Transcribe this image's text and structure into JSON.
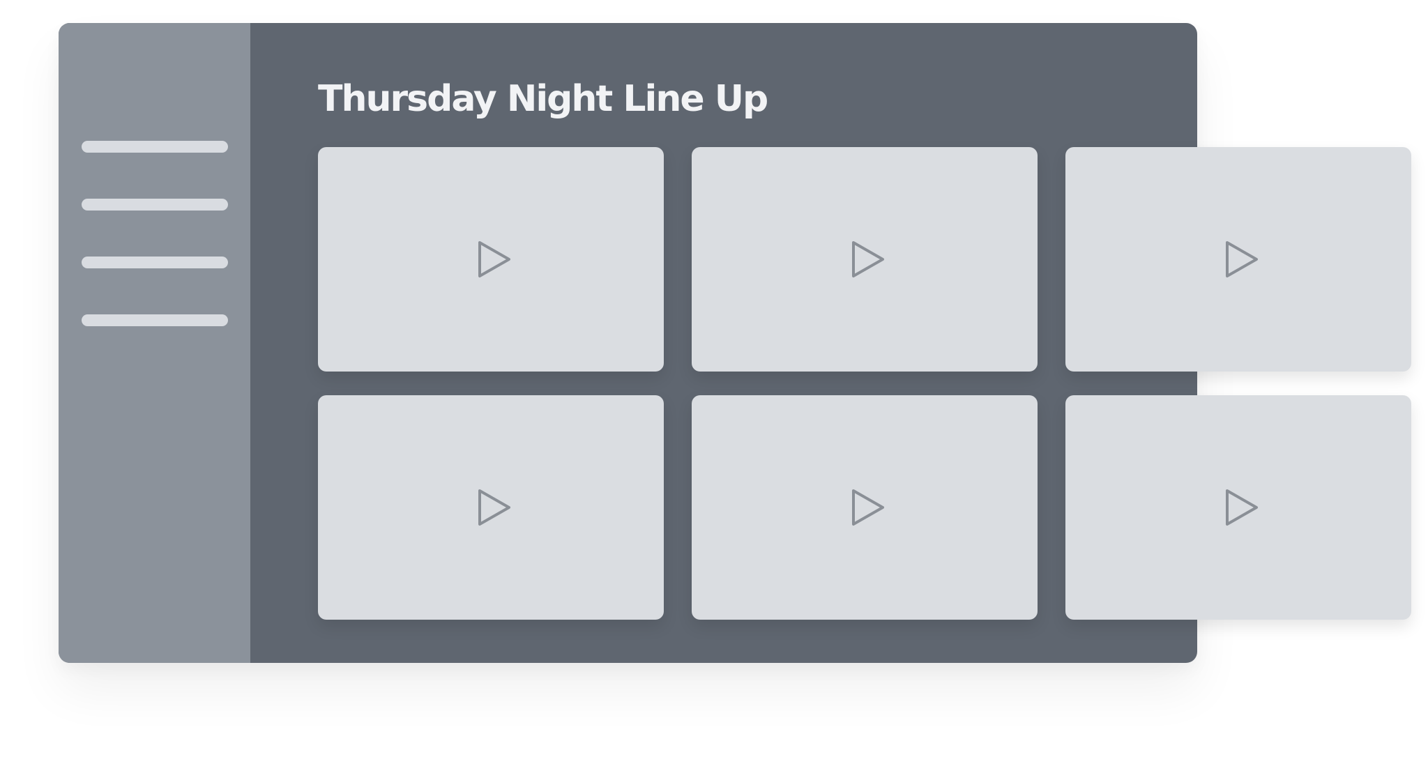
{
  "page": {
    "title": "Thursday Night Line Up"
  },
  "sidebar": {
    "items": [
      {
        "icon": "menu-line"
      },
      {
        "icon": "menu-line"
      },
      {
        "icon": "menu-line"
      },
      {
        "icon": "menu-line"
      }
    ]
  },
  "videos": [
    {
      "icon": "play-icon"
    },
    {
      "icon": "play-icon"
    },
    {
      "icon": "play-icon"
    },
    {
      "icon": "play-icon"
    },
    {
      "icon": "play-icon"
    },
    {
      "icon": "play-icon"
    }
  ],
  "colors": {
    "window_bg": "#5f6670",
    "sidebar_bg": "#8b929b",
    "card_bg": "#dadde1",
    "play_icon": "#8a8f96",
    "title_text": "#f2f3f5"
  }
}
